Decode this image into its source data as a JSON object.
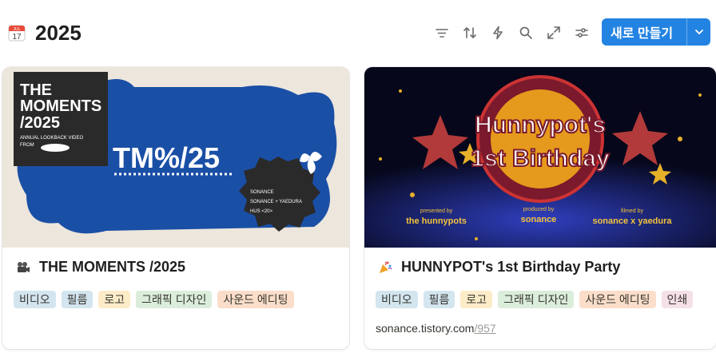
{
  "header": {
    "title": "2025",
    "calendar_icon": {
      "month": "JUL",
      "day": "17"
    },
    "toolbar_icons": [
      "filter-icon",
      "sort-icon",
      "automation-icon",
      "search-icon",
      "expand-icon",
      "settings-icon"
    ],
    "new_button_label": "새로 만들기"
  },
  "colors": {
    "accent": "#2383e2",
    "tag_blue": "#d3e5ef",
    "tag_yellow": "#fdecc8",
    "tag_green": "#dbeddb",
    "tag_orange": "#fadec9",
    "tag_pink": "#f5e0e9"
  },
  "cards": [
    {
      "emoji": "movie-camera-icon",
      "title": "THE MOMENTS /2025",
      "tags": [
        "비디오",
        "필름",
        "로고",
        "그래픽 디자인",
        "사운드 에디팅"
      ],
      "cover": {
        "box_title": [
          "THE",
          "MOMENTS",
          "/2025"
        ],
        "box_sub": [
          "ANNUAL LOOKBACK VIDEO",
          "FROM"
        ],
        "center_text": "TM%/25",
        "badge_lines": [
          "SONANCE",
          "SONANCE + YAEDURA",
          "HUS <20>"
        ]
      }
    },
    {
      "emoji": "party-popper-icon",
      "title": "HUNNYPOT's 1st Birthday Party",
      "tags": [
        "비디오",
        "필름",
        "로고",
        "그래픽 디자인",
        "사운드 에디팅",
        "인쇄"
      ],
      "url_domain": "sonance.tistory.com",
      "url_path": "/957",
      "cover": {
        "line1": "Hunnypot's",
        "line2": "1st Birthday",
        "credit1_label": "presented by",
        "credit1_name": "the hunnypots",
        "credit2_label": "produced by",
        "credit2_name": "sonance",
        "credit3_label": "filmed by",
        "credit3_name": "sonance x yaedura"
      }
    }
  ]
}
